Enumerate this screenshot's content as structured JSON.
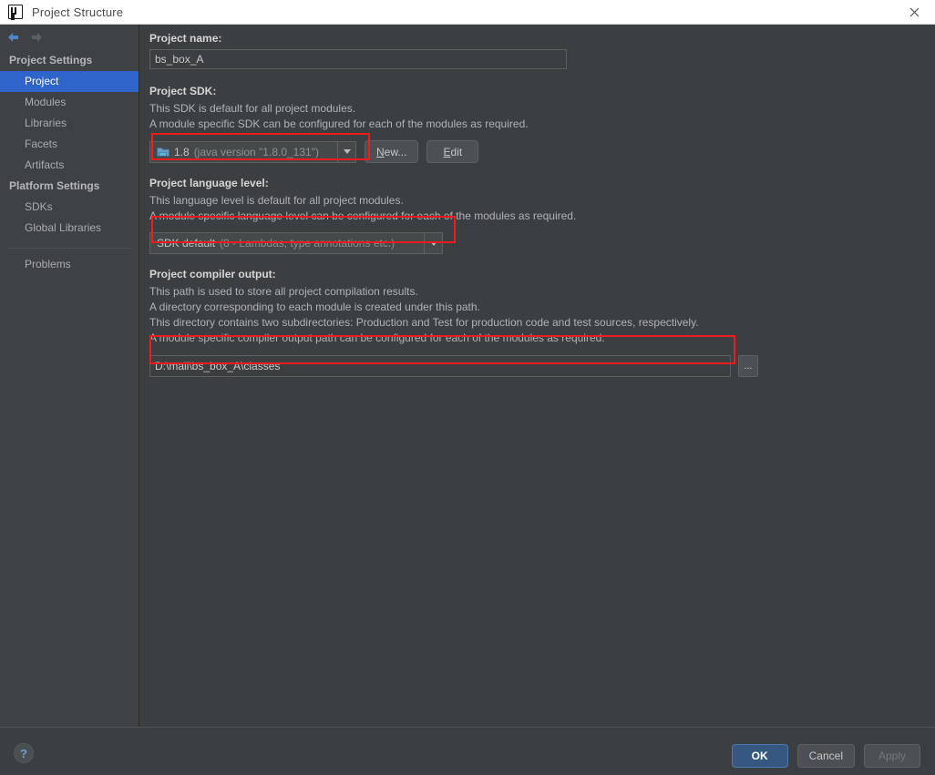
{
  "window": {
    "title": "Project Structure",
    "logo_icon": "intellij-idea-logo",
    "close_icon": "close-icon"
  },
  "navigation": {
    "back_icon": "arrow-back-icon",
    "forward_icon": "arrow-forward-icon"
  },
  "sidebar": {
    "sections": [
      {
        "title": "Project Settings",
        "items": [
          {
            "label": "Project",
            "selected": true
          },
          {
            "label": "Modules",
            "selected": false
          },
          {
            "label": "Libraries",
            "selected": false
          },
          {
            "label": "Facets",
            "selected": false
          },
          {
            "label": "Artifacts",
            "selected": false
          }
        ]
      },
      {
        "title": "Platform Settings",
        "items": [
          {
            "label": "SDKs",
            "selected": false
          },
          {
            "label": "Global Libraries",
            "selected": false
          }
        ]
      }
    ],
    "problems": {
      "label": "Problems"
    }
  },
  "main": {
    "project_name": {
      "label": "Project name:",
      "value": "bs_box_A",
      "placeholder": ""
    },
    "project_sdk": {
      "label": "Project SDK:",
      "desc1": "This SDK is default for all project modules.",
      "desc2": "A module specific SDK can be configured for each of the modules as required.",
      "icon": "sdk-folder-icon",
      "value_name": "1.8",
      "value_detail": "(java version \"1.8.0_131\")",
      "new_button": {
        "prefix": "",
        "mnemonic": "N",
        "suffix": "ew..."
      },
      "edit_button": {
        "prefix": "",
        "mnemonic": "E",
        "suffix": "dit"
      }
    },
    "language_level": {
      "label": "Project language level:",
      "desc1": "This language level is default for all project modules.",
      "desc2": "A module specific language level can be configured for each of the modules as required.",
      "value_name": "SDK default",
      "value_detail": "(8 - Lambdas, type annotations etc.)"
    },
    "compiler_output": {
      "label": "Project compiler output:",
      "desc1": "This path is used to store all project compilation results.",
      "desc2": "A directory corresponding to each module is created under this path.",
      "desc3": "This directory contains two subdirectories: Production and Test for production code and test sources, respectively.",
      "desc4": "A module specific compiler output path can be configured for each of the modules as required.",
      "value": "D:\\mall\\bs_box_A\\classes",
      "placeholder": "",
      "browse_label": "...",
      "browse_icon": "browse-ellipsis-icon"
    }
  },
  "footer": {
    "help_label": "?",
    "help_icon": "help-question-icon",
    "ok_label": "OK",
    "cancel_label": "Cancel",
    "apply_label": "Apply"
  },
  "annotations": {
    "color": "#ee1c1c",
    "boxes": [
      {
        "name": "sdk-row-highlight"
      },
      {
        "name": "language-level-highlight"
      },
      {
        "name": "compiler-output-highlight"
      }
    ]
  }
}
